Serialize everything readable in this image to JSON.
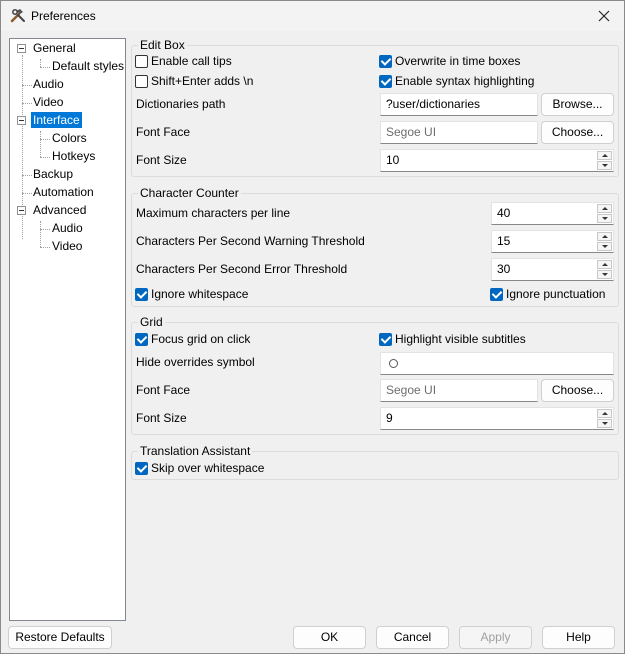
{
  "window": {
    "title": "Preferences",
    "icon": "hammer-wrench-icon"
  },
  "tree": {
    "general": "General",
    "default_styles": "Default styles",
    "audio": "Audio",
    "video": "Video",
    "interface": "Interface",
    "colors": "Colors",
    "hotkeys": "Hotkeys",
    "backup": "Backup",
    "automation": "Automation",
    "advanced": "Advanced",
    "adv_audio": "Audio",
    "adv_video": "Video"
  },
  "edit_box": {
    "title": "Edit Box",
    "enable_call_tips": {
      "label": "Enable call tips",
      "checked": false
    },
    "shift_enter": {
      "label": "Shift+Enter adds \\n",
      "checked": false
    },
    "overwrite_time_boxes": {
      "label": "Overwrite in time boxes",
      "checked": true
    },
    "syntax_highlighting": {
      "label": "Enable syntax highlighting",
      "checked": true
    },
    "dictionaries_label": "Dictionaries path",
    "dictionaries_value": "?user/dictionaries",
    "browse_button": "Browse...",
    "font_face_label": "Font Face",
    "font_face_value": "Segoe UI",
    "choose_button": "Choose...",
    "font_size_label": "Font Size",
    "font_size_value": "10"
  },
  "char_counter": {
    "title": "Character Counter",
    "max_chars_label": "Maximum characters per line",
    "max_chars_value": "40",
    "cps_warning_label": "Characters Per Second Warning Threshold",
    "cps_warning_value": "15",
    "cps_error_label": "Characters Per Second Error Threshold",
    "cps_error_value": "30",
    "ignore_whitespace": {
      "label": "Ignore whitespace",
      "checked": true
    },
    "ignore_punctuation": {
      "label": "Ignore punctuation",
      "checked": true
    }
  },
  "grid": {
    "title": "Grid",
    "focus_grid": {
      "label": "Focus grid on click",
      "checked": true
    },
    "highlight_visible": {
      "label": "Highlight visible subtitles",
      "checked": true
    },
    "hide_overrides_label": "Hide overrides symbol",
    "hide_overrides_value": "",
    "font_face_label": "Font Face",
    "font_face_value": "Segoe UI",
    "choose_button": "Choose...",
    "font_size_label": "Font Size",
    "font_size_value": "9"
  },
  "translation": {
    "title": "Translation Assistant",
    "skip_whitespace": {
      "label": "Skip over whitespace",
      "checked": true
    }
  },
  "footer": {
    "restore_defaults": "Restore Defaults",
    "ok": "OK",
    "cancel": "Cancel",
    "apply": "Apply",
    "help": "Help"
  },
  "colors": {
    "selection": "#0078d7",
    "checkbox": "#0067c0"
  }
}
